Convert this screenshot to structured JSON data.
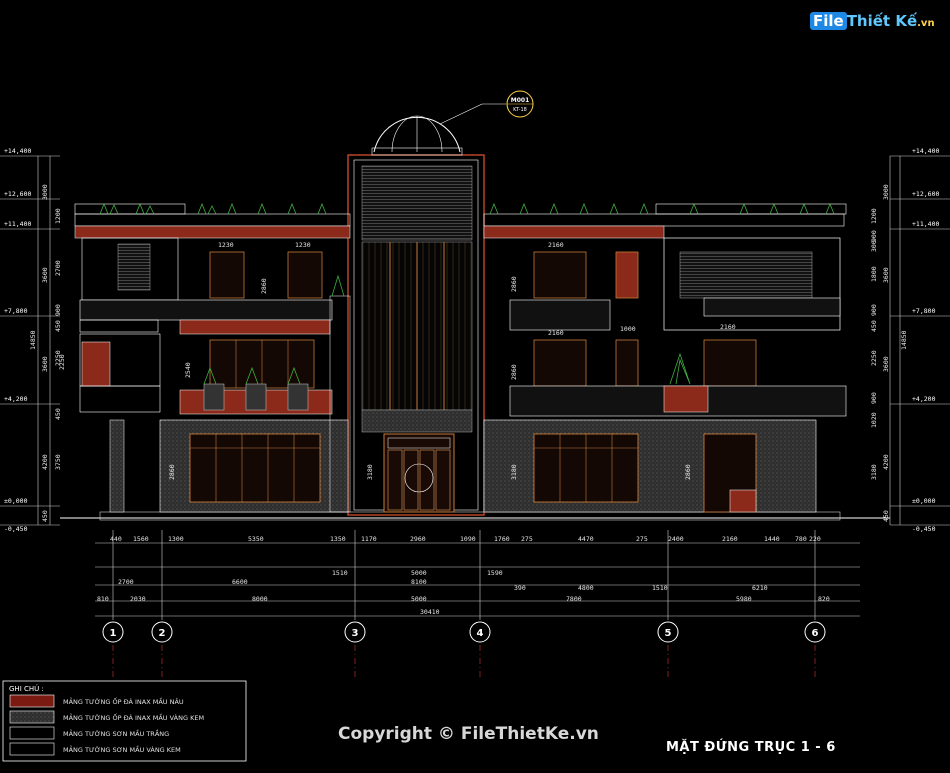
{
  "watermark_logo": {
    "first": "File",
    "second": "Thiết Kế",
    "suffix": ".vn"
  },
  "copyright": "Copyright © FileThietKe.vn",
  "sheet_title": "MẶT ĐỨNG TRỤC 1 - 6",
  "detail_callout": {
    "code": "M001",
    "ref": "KT-18"
  },
  "levels_left": [
    "+14,400",
    "+12,600",
    "+11,400",
    "+7,800",
    "+4,200",
    "±0,000",
    "-0,450"
  ],
  "levels_right": [
    "+14,400",
    "+12,600",
    "+11,400",
    "+7,800",
    "+4,200",
    "±0,000",
    "-0,450"
  ],
  "vertical_dims_left": [
    "3000",
    "1200",
    "2700",
    "3600",
    "900",
    "450",
    "2250",
    "3600",
    "450",
    "4200",
    "3750",
    "450",
    "14850"
  ],
  "vertical_dims_right": [
    "3000",
    "1200",
    "900",
    "300",
    "1800",
    "3600",
    "900",
    "450",
    "2250",
    "3600",
    "900",
    "1020",
    "4200",
    "3180",
    "450",
    "14850"
  ],
  "opening_dims": [
    "1230",
    "1230",
    "2860",
    "2160",
    "2860",
    "2160",
    "1000",
    "2160",
    "2540",
    "2860",
    "3180",
    "2860",
    "3180",
    "2860",
    "2250"
  ],
  "dim_row_1": [
    "440",
    "1560",
    "1300",
    "5350",
    "1350",
    "1170",
    "2960",
    "1090",
    "1760",
    "275",
    "4470",
    "275",
    "2400",
    "2160",
    "1440",
    "780",
    "220"
  ],
  "dim_row_2": [
    "1510",
    "5000",
    "1590"
  ],
  "dim_row_3": [
    "2700",
    "6600",
    "8100",
    "390",
    "4800",
    "1510",
    "6210"
  ],
  "dim_row_4": [
    "810",
    "2030",
    "8000",
    "5000",
    "7800",
    "5980",
    "820"
  ],
  "dim_total": "30410",
  "axes": [
    "1",
    "2",
    "3",
    "4",
    "5",
    "6"
  ],
  "legend": {
    "title": "GHI CHÚ :",
    "items": [
      {
        "label": "MẢNG TƯỜNG ỐP ĐÁ INAX MẦU NÂU",
        "color": "#7a1a10"
      },
      {
        "label": "MẢNG TƯỜNG ỐP ĐÁ INAX MẦU VÀNG KEM",
        "color": "#3a3a3a"
      },
      {
        "label": "MẢNG TƯỜNG SƠN MẦU TRẮNG",
        "color": "#000000"
      },
      {
        "label": "MẢNG TƯỜNG SƠN MẦU VÀNG KEM",
        "color": "#000000"
      }
    ]
  },
  "colors": {
    "line": "#ffffff",
    "dim": "#e0e0e0",
    "brown": "#8b2a1a",
    "stone": "#404040",
    "glass": "#c47a3a",
    "axis_line": "#ff4040",
    "tree": "#3fae3f"
  }
}
